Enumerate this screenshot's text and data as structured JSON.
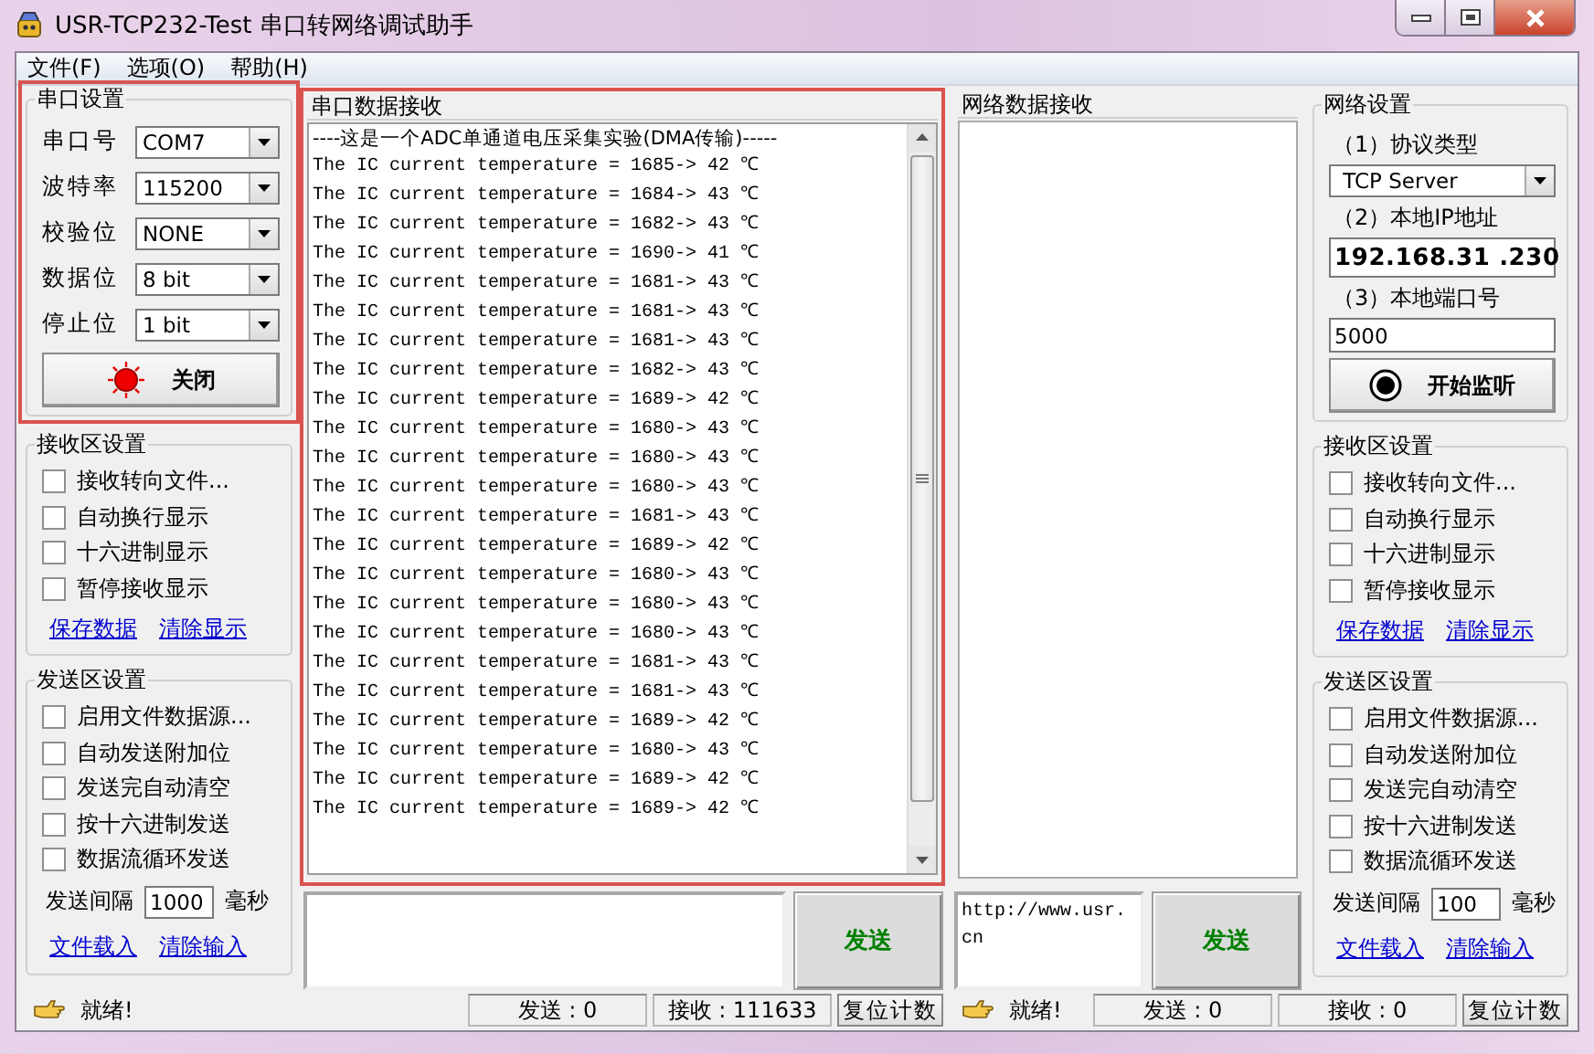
{
  "window": {
    "title": "USR-TCP232-Test 串口转网络调试助手"
  },
  "menu": [
    {
      "label": "文件(F)"
    },
    {
      "label": "选项(O)"
    },
    {
      "label": "帮助(H)"
    }
  ],
  "serial_settings": {
    "title": "串口设置",
    "highlighted": true,
    "fields": [
      {
        "label": "串口号",
        "value": "COM7"
      },
      {
        "label": "波特率",
        "value": "115200"
      },
      {
        "label": "校验位",
        "value": "NONE"
      },
      {
        "label": "数据位",
        "value": "8 bit"
      },
      {
        "label": "停止位",
        "value": "1 bit"
      }
    ],
    "button": {
      "label": "关闭",
      "on": true
    }
  },
  "serial_receive_settings": {
    "title": "接收区设置",
    "options": [
      {
        "label": "接收转向文件...",
        "checked": false
      },
      {
        "label": "自动换行显示",
        "checked": false
      },
      {
        "label": "十六进制显示",
        "checked": false
      },
      {
        "label": "暂停接收显示",
        "checked": false
      }
    ],
    "links": [
      "保存数据",
      "清除显示"
    ]
  },
  "serial_send_settings": {
    "title": "发送区设置",
    "options": [
      {
        "label": "启用文件数据源...",
        "checked": false
      },
      {
        "label": "自动发送附加位",
        "checked": false
      },
      {
        "label": "发送完自动清空",
        "checked": false
      },
      {
        "label": "按十六进制发送",
        "checked": false
      },
      {
        "label": "数据流循环发送",
        "checked": false
      }
    ],
    "interval": {
      "label": "发送间隔",
      "value": "1000",
      "unit": "毫秒"
    },
    "links": [
      "文件载入",
      "清除输入"
    ]
  },
  "serial_receive": {
    "title": "串口数据接收",
    "highlighted": true,
    "lines": [
      "----这是一个ADC单通道电压采集实验(DMA传输)-----",
      "The IC current temperature = 1685-> 42 ℃",
      "The IC current temperature = 1684-> 43 ℃",
      "The IC current temperature = 1682-> 43 ℃",
      "The IC current temperature = 1690-> 41 ℃",
      "The IC current temperature = 1681-> 43 ℃",
      "The IC current temperature = 1681-> 43 ℃",
      "The IC current temperature = 1681-> 43 ℃",
      "The IC current temperature = 1682-> 43 ℃",
      "The IC current temperature = 1689-> 42 ℃",
      "The IC current temperature = 1680-> 43 ℃",
      "The IC current temperature = 1680-> 43 ℃",
      "The IC current temperature = 1680-> 43 ℃",
      "The IC current temperature = 1681-> 43 ℃",
      "The IC current temperature = 1689-> 42 ℃",
      "The IC current temperature = 1680-> 43 ℃",
      "The IC current temperature = 1680-> 43 ℃",
      "The IC current temperature = 1680-> 43 ℃",
      "The IC current temperature = 1681-> 43 ℃",
      "The IC current temperature = 1681-> 43 ℃",
      "The IC current temperature = 1689-> 42 ℃",
      "The IC current temperature = 1680-> 43 ℃",
      "The IC current temperature = 1689-> 42 ℃",
      "The IC current temperature = 1689-> 42 ℃"
    ]
  },
  "serial_send": {
    "button": "发送"
  },
  "serial_status": {
    "state": "就绪!",
    "sent": "发送 : 0",
    "received": "接收 : 111633",
    "reset": "复位计数"
  },
  "network_receive": {
    "title": "网络数据接收"
  },
  "network_send": {
    "value": "http://www.usr.cn",
    "button": "发送"
  },
  "network_settings": {
    "title": "网络设置",
    "protocol_label": "（1）协议类型",
    "protocol": "TCP Server",
    "ip_label": "（2）本地IP地址",
    "ip": "192.168.31 .230",
    "port_label": "（3）本地端口号",
    "port": "5000",
    "button": {
      "label": "开始监听",
      "on": false
    }
  },
  "network_receive_settings": {
    "title": "接收区设置",
    "options": [
      {
        "label": "接收转向文件...",
        "checked": false
      },
      {
        "label": "自动换行显示",
        "checked": false
      },
      {
        "label": "十六进制显示",
        "checked": false
      },
      {
        "label": "暂停接收显示",
        "checked": false
      }
    ],
    "links": [
      "保存数据",
      "清除显示"
    ]
  },
  "network_send_settings": {
    "title": "发送区设置",
    "options": [
      {
        "label": "启用文件数据源...",
        "checked": false
      },
      {
        "label": "自动发送附加位",
        "checked": false
      },
      {
        "label": "发送完自动清空",
        "checked": false
      },
      {
        "label": "按十六进制发送",
        "checked": false
      },
      {
        "label": "数据流循环发送",
        "checked": false
      }
    ],
    "interval": {
      "label": "发送间隔",
      "value": "100",
      "unit": "毫秒"
    },
    "links": [
      "文件载入",
      "清除输入"
    ]
  },
  "network_status": {
    "state": "就绪!",
    "sent": "发送 : 0",
    "received": "接收 : 0",
    "reset": "复位计数"
  }
}
